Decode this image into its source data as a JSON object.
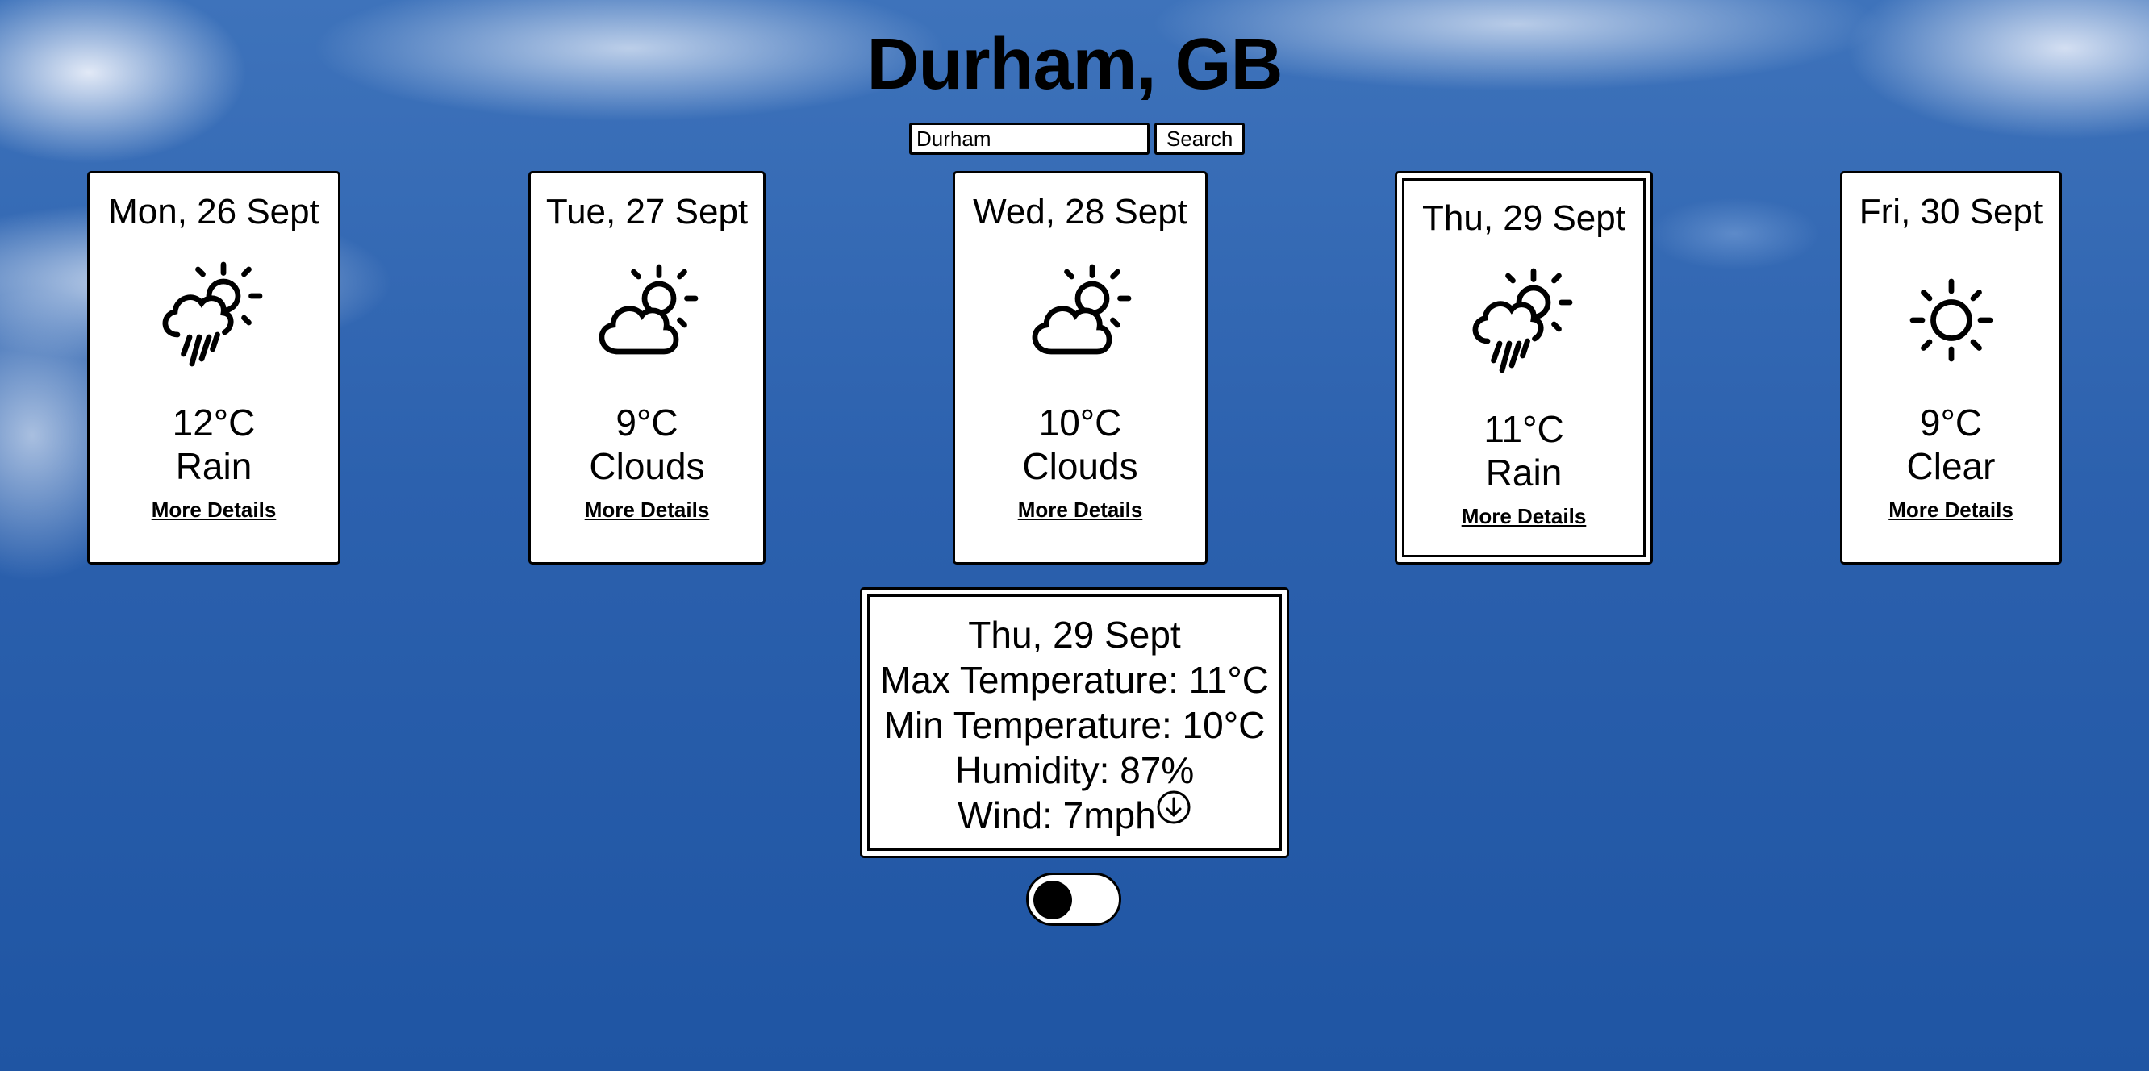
{
  "header": {
    "city": "Durham, GB"
  },
  "search": {
    "value": "Durham",
    "button_label": "Search"
  },
  "forecast": [
    {
      "date": "Mon, 26 Sept",
      "temp": "12°C",
      "condition": "Rain",
      "icon": "cloud-sun-rain-icon",
      "link": "More Details"
    },
    {
      "date": "Tue, 27 Sept",
      "temp": "9°C",
      "condition": "Clouds",
      "icon": "cloud-sun-icon",
      "link": "More Details"
    },
    {
      "date": "Wed, 28 Sept",
      "temp": "10°C",
      "condition": "Clouds",
      "icon": "cloud-sun-icon",
      "link": "More Details"
    },
    {
      "date": "Thu, 29 Sept",
      "temp": "11°C",
      "condition": "Rain",
      "icon": "cloud-sun-rain-icon",
      "link": "More Details",
      "selected": true
    },
    {
      "date": "Fri, 30 Sept",
      "temp": "9°C",
      "condition": "Clear",
      "icon": "sun-icon",
      "link": "More Details"
    }
  ],
  "details": {
    "date": "Thu, 29 Sept",
    "max_temp": "Max Temperature: 11°C",
    "min_temp": "Min Temperature: 10°C",
    "humidity": "Humidity: 87%",
    "wind": "Wind: 7mph",
    "wind_icon": "arrow-down-circle-icon"
  },
  "toggle": {
    "state": "off"
  }
}
